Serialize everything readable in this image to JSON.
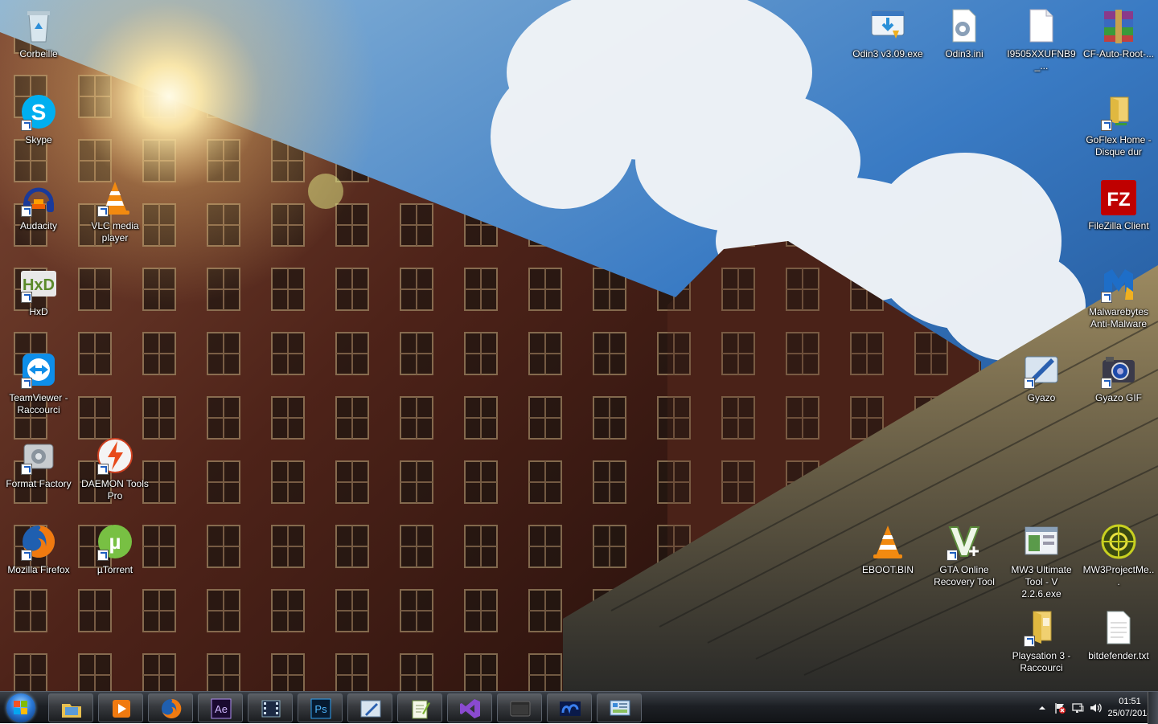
{
  "desktop": {
    "icons": [
      {
        "id": "recycle-bin",
        "label": "Corbeille",
        "icon": "recycle-bin-icon",
        "shortcut": false
      },
      {
        "id": "skype",
        "label": "Skype",
        "icon": "skype-icon",
        "shortcut": true
      },
      {
        "id": "audacity",
        "label": "Audacity",
        "icon": "audacity-icon",
        "shortcut": true
      },
      {
        "id": "vlc",
        "label": "VLC media player",
        "icon": "vlc-icon",
        "shortcut": true
      },
      {
        "id": "hxd",
        "label": "HxD",
        "icon": "hxd-icon",
        "shortcut": true
      },
      {
        "id": "teamviewer",
        "label": "TeamViewer - Raccourci",
        "icon": "teamviewer-icon",
        "shortcut": true
      },
      {
        "id": "format-factory",
        "label": "Format Factory",
        "icon": "format-factory-icon",
        "shortcut": true
      },
      {
        "id": "daemon-tools",
        "label": "DAEMON Tools Pro",
        "icon": "daemon-tools-icon",
        "shortcut": true
      },
      {
        "id": "firefox",
        "label": "Mozilla Firefox",
        "icon": "firefox-icon",
        "shortcut": true
      },
      {
        "id": "utorrent",
        "label": "µTorrent",
        "icon": "utorrent-icon",
        "shortcut": true
      },
      {
        "id": "odin-exe",
        "label": "Odin3 v3.09.exe",
        "icon": "installer-icon",
        "shortcut": false
      },
      {
        "id": "odin-ini",
        "label": "Odin3.ini",
        "icon": "ini-file-icon",
        "shortcut": false
      },
      {
        "id": "i9505",
        "label": "I9505XXUFNB9_...",
        "icon": "blank-file-icon",
        "shortcut": false
      },
      {
        "id": "cf-auto-root",
        "label": "CF-Auto-Root-...",
        "icon": "winrar-icon",
        "shortcut": false
      },
      {
        "id": "goflex",
        "label": "GoFlex Home - Disque dur",
        "icon": "network-folder-icon",
        "shortcut": true
      },
      {
        "id": "filezilla",
        "label": "FileZilla Client",
        "icon": "filezilla-icon",
        "shortcut": true
      },
      {
        "id": "malwarebytes",
        "label": "Malwarebytes Anti-Malware",
        "icon": "malwarebytes-icon",
        "shortcut": true
      },
      {
        "id": "gyazo",
        "label": "Gyazo",
        "icon": "gyazo-icon",
        "shortcut": true
      },
      {
        "id": "gyazo-gif",
        "label": "Gyazo GIF",
        "icon": "gyazo-gif-icon",
        "shortcut": true
      },
      {
        "id": "eboot",
        "label": "EBOOT.BIN",
        "icon": "vlc-icon",
        "shortcut": false
      },
      {
        "id": "gta-recovery",
        "label": "GTA Online Recovery Tool",
        "icon": "gta-v-icon",
        "shortcut": true
      },
      {
        "id": "mw3-ultimate",
        "label": "MW3 Ultimate Tool - V 2.2.6.exe",
        "icon": "app-window-icon",
        "shortcut": false
      },
      {
        "id": "mw3-project",
        "label": "MW3ProjectMe...",
        "icon": "mw3-project-icon",
        "shortcut": false
      },
      {
        "id": "ps3-folder",
        "label": "Playsation 3 - Raccourci",
        "icon": "folder-icon",
        "shortcut": true
      },
      {
        "id": "bitdefender",
        "label": "bitdefender.txt",
        "icon": "text-file-icon",
        "shortcut": false
      }
    ]
  },
  "taskbar": {
    "start_icon": "windows-orb-icon",
    "pinned": [
      {
        "id": "explorer",
        "icon": "explorer-icon"
      },
      {
        "id": "media-player",
        "icon": "media-player-icon"
      },
      {
        "id": "firefox",
        "icon": "firefox-icon"
      },
      {
        "id": "after-effects",
        "icon": "after-effects-icon",
        "text": "Ae"
      },
      {
        "id": "video-editor",
        "icon": "film-icon"
      },
      {
        "id": "photoshop",
        "icon": "photoshop-icon",
        "text": "Ps"
      },
      {
        "id": "gyazo",
        "icon": "gyazo-icon"
      },
      {
        "id": "notepad-plus",
        "icon": "notepad-plus-icon"
      },
      {
        "id": "visual-studio",
        "icon": "visual-studio-icon"
      },
      {
        "id": "blank-window",
        "icon": "window-icon"
      },
      {
        "id": "nc-app",
        "icon": "nc-app-icon"
      },
      {
        "id": "control-panel",
        "icon": "control-panel-icon"
      }
    ],
    "tray": {
      "icons": [
        "show-hidden-icon",
        "action-center-flag-icon",
        "network-icon",
        "volume-icon"
      ],
      "time": "01:51",
      "date": "25/07/2014"
    }
  },
  "colors": {
    "taskbar": "#1d2025",
    "sky": "#2f6fb8",
    "brick": "#5a2a20"
  }
}
